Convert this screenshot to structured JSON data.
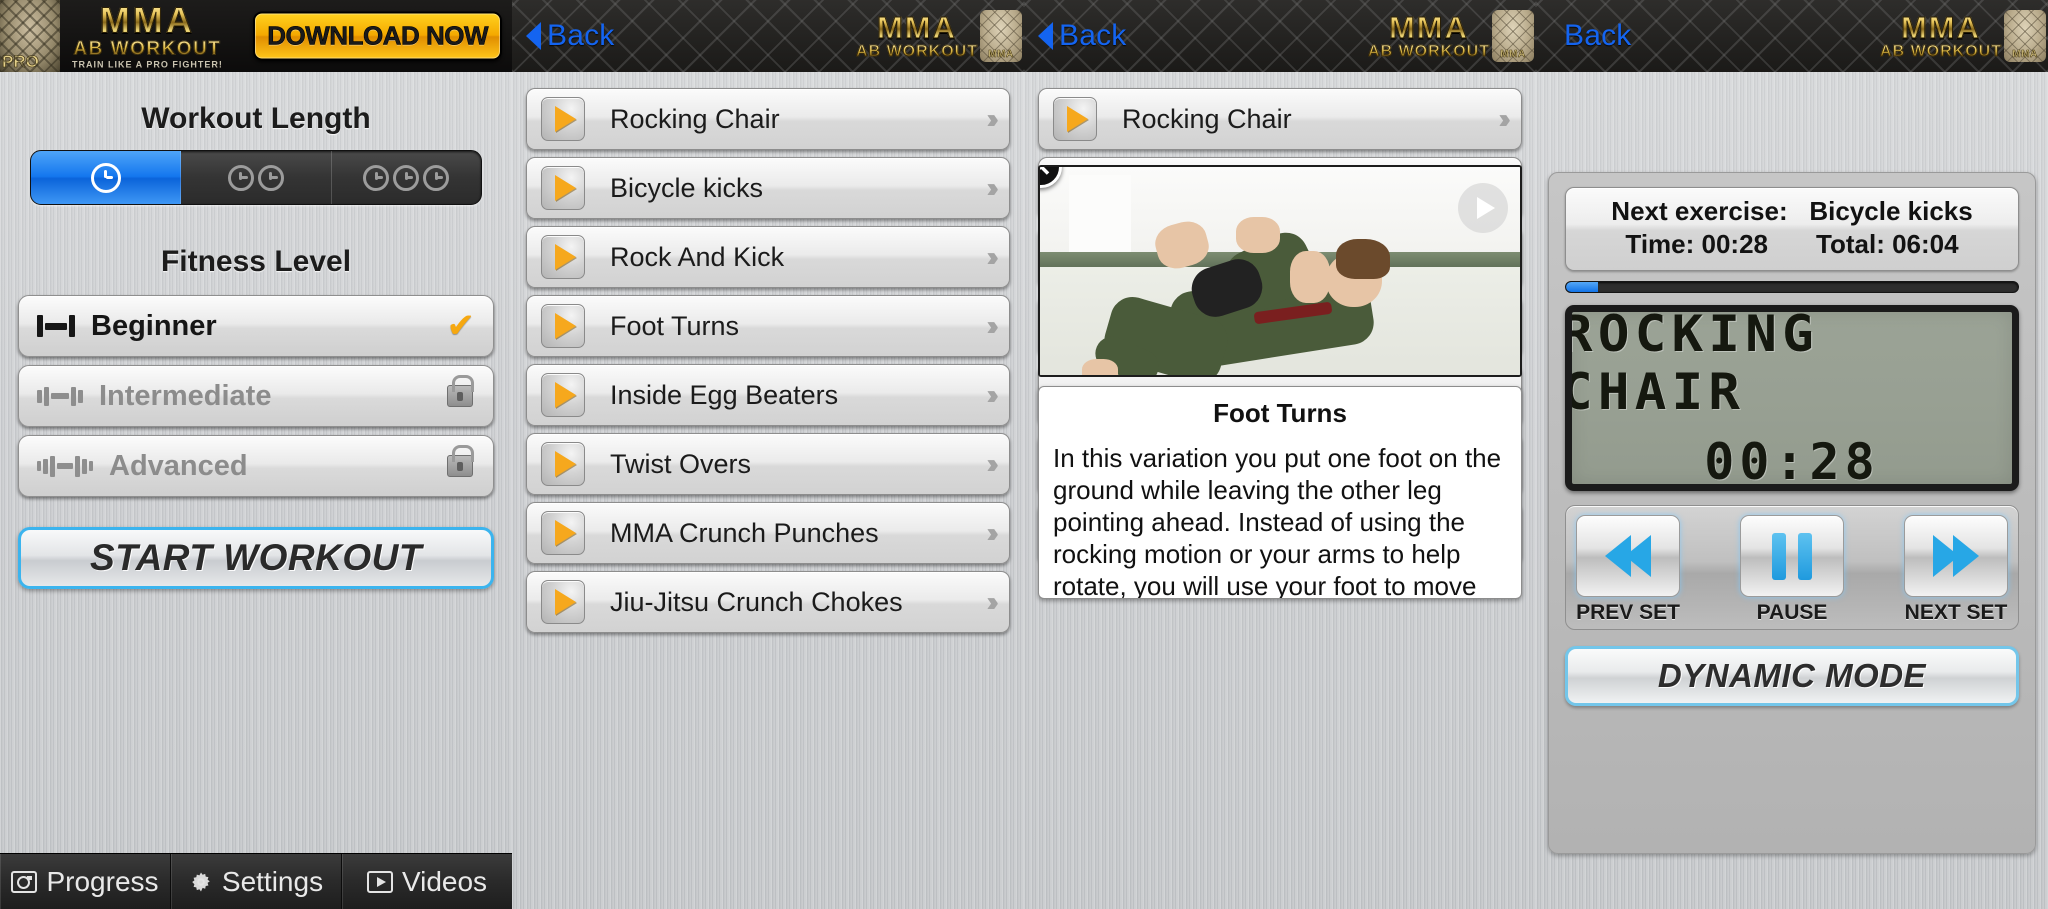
{
  "app": {
    "logo_main": "MMA",
    "logo_sub": "AB WORKOUT",
    "tagline": "TRAIN LIKE A PRO FIGHTER!",
    "pro_badge": "PRO",
    "torso_caption": "MMA",
    "download_label": "DOWNLOAD NOW",
    "back_label": "Back"
  },
  "panel1": {
    "workout_length_title": "Workout Length",
    "length_options": [
      {
        "id": "short",
        "icon": "clock-icon",
        "clocks": 1,
        "selected": true
      },
      {
        "id": "medium",
        "icon": "clock-icon",
        "clocks": 2,
        "selected": false
      },
      {
        "id": "long",
        "icon": "clock-icon",
        "clocks": 3,
        "selected": false
      }
    ],
    "fitness_level_title": "Fitness Level",
    "levels": [
      {
        "name": "Beginner",
        "locked": false,
        "selected": true,
        "status_icon": "check-icon",
        "weights": 1
      },
      {
        "name": "Intermediate",
        "locked": true,
        "selected": false,
        "status_icon": "lock-icon",
        "weights": 2
      },
      {
        "name": "Advanced",
        "locked": true,
        "selected": false,
        "status_icon": "lock-icon",
        "weights": 3
      }
    ],
    "start_label": "START WORKOUT",
    "tabs": [
      {
        "label": "Progress",
        "icon": "camera-icon"
      },
      {
        "label": "Settings",
        "icon": "gear-icon"
      },
      {
        "label": "Videos",
        "icon": "video-icon"
      }
    ]
  },
  "panel2": {
    "exercises": [
      "Rocking Chair",
      "Bicycle kicks",
      "Rock And Kick",
      "Foot Turns",
      "Inside Egg Beaters",
      "Twist Overs",
      "MMA Crunch Punches",
      "Jiu-Jitsu Crunch Chokes"
    ]
  },
  "panel3": {
    "top_row_label": "Rocking Chair",
    "close_glyph": "✕",
    "video_play_icon": "play-icon",
    "detail_title": "Foot Turns",
    "detail_body": "In this variation you put one foot on the ground while leaving the other leg pointing ahead. Instead of using the rocking motion or your arms to help rotate, you will use your foot to move you around in a circle. Do not step with your foot then drag your bottom along the ground but use your planted foot to lift your"
  },
  "panel4": {
    "next_prefix": "Next exercise:",
    "next_exercise": "Bicycle kicks",
    "time_label": "Time:",
    "time_value": "00:28",
    "total_label": "Total:",
    "total_value": "06:04",
    "progress_percent": 7,
    "lcd_title": "ROCKING CHAIR",
    "lcd_time": "00:28",
    "controls": [
      {
        "label": "PREV SET",
        "icon": "rewind-icon"
      },
      {
        "label": "PAUSE",
        "icon": "pause-icon"
      },
      {
        "label": "NEXT SET",
        "icon": "fast-forward-icon"
      }
    ],
    "dynamic_mode_label": "DYNAMIC MODE"
  },
  "colors": {
    "accent_blue": "#1477ee",
    "gold": "#f6a81d",
    "link_blue": "#1464f0",
    "lcd_bg": "#98a093"
  }
}
